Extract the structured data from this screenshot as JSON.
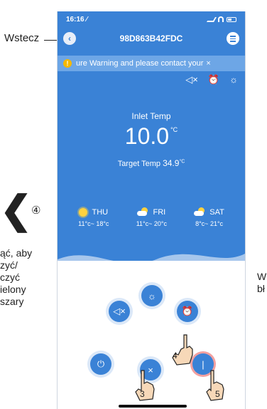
{
  "annotations": {
    "back_label": "Wstecz",
    "left_badge": "④",
    "left_text": "ąć, aby\nzyć/\nczyć\nielony\nszary",
    "right_text": "W\nbł"
  },
  "statusbar": {
    "time": "16:16 ⁄"
  },
  "nav": {
    "title": "98D863B42FDC",
    "back_icon": "‹"
  },
  "warning": {
    "text": "ure Warning and please contact your",
    "close": "×",
    "icon": "!"
  },
  "top_icons": {
    "mute": "◁×",
    "timer": "⏰",
    "sun": "☼"
  },
  "inlet": {
    "label": "Inlet Temp",
    "value": "10.0",
    "unit": "°C"
  },
  "target": {
    "label": "Target Temp",
    "value": "34.9",
    "unit": "°C"
  },
  "forecast": [
    {
      "day": "THU",
      "range": "11°c~ 18°c",
      "icon": "sun-icon"
    },
    {
      "day": "FRI",
      "range": "11°c~ 20°c",
      "icon": "cloud-sun-icon"
    },
    {
      "day": "SAT",
      "range": "8°c~ 21°c",
      "icon": "cloud-sun-icon"
    }
  ],
  "controls": {
    "mute": "◁×",
    "sun": "☼",
    "timer": "⏰",
    "power": "⏻",
    "close": "×",
    "mode": "|"
  },
  "hand_labels": {
    "h3": "3",
    "h4": "4",
    "h5": "5"
  },
  "colors": {
    "primary": "#3a82d6",
    "warning_bg": "#6da6e6",
    "warn_icon": "#f5b800"
  }
}
